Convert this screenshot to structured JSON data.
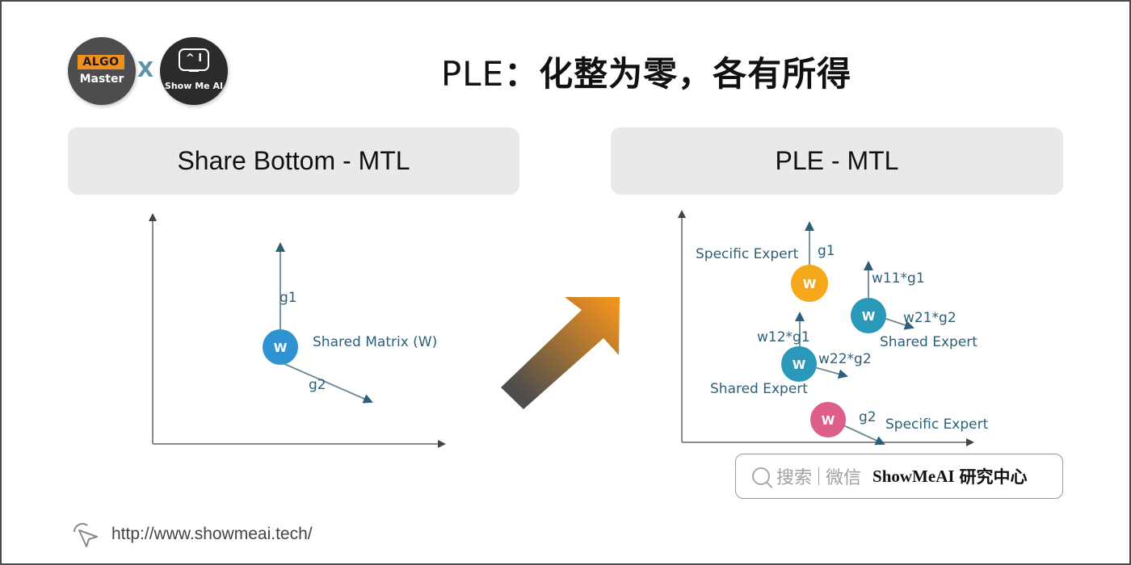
{
  "logos": {
    "algo": {
      "tag": "ALGO",
      "sub": "Master"
    },
    "separator": "X",
    "showmeai": {
      "face": "^ I",
      "sub": "Show Me AI"
    }
  },
  "title": {
    "en": "PLE",
    "colon": "：",
    "cn": "化整为零，各有所得"
  },
  "panels": {
    "left": {
      "heading": "Share Bottom - MTL"
    },
    "right": {
      "heading": "PLE - MTL"
    }
  },
  "left_diagram": {
    "node": {
      "label": "W",
      "color": "#2f93d1"
    },
    "vectors": [
      "g1",
      "g2"
    ],
    "annotation": "Shared Matrix  (W)"
  },
  "right_diagram": {
    "nodes": [
      {
        "label": "W",
        "role": "Specific Expert",
        "gradient": "g1",
        "color": "#f5a91a"
      },
      {
        "label": "W",
        "role": "Shared Expert",
        "gradients": [
          "w11*g1",
          "w21*g2"
        ],
        "color": "#2a98b8"
      },
      {
        "label": "W",
        "role": "Shared Expert",
        "gradients": [
          "w12*g1",
          "w22*g2"
        ],
        "color": "#2a98b8"
      },
      {
        "label": "W",
        "role": "Specific Expert",
        "gradient": "g2",
        "color": "#dd5f88"
      }
    ]
  },
  "arrow": {
    "from_color": "#4d4d4d",
    "to_color": "#f0921e"
  },
  "search": {
    "hint_a": "搜索",
    "hint_b": "微信",
    "brand": "ShowMeAI",
    "brand_cn": "研究中心"
  },
  "footer": {
    "url": "http://www.showmeai.tech/"
  }
}
